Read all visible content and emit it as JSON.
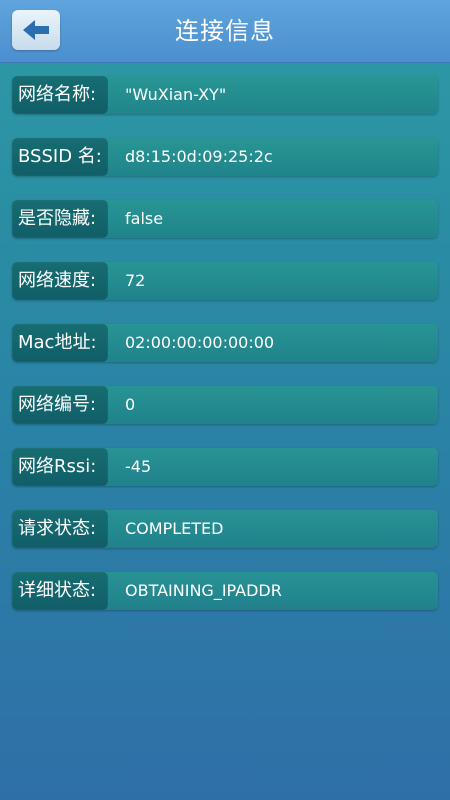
{
  "header": {
    "title": "连接信息",
    "back_icon": "back-arrow-icon"
  },
  "rows": [
    {
      "label": "网络名称:",
      "value": "\"WuXian-XY\""
    },
    {
      "label": "BSSID 名:",
      "value": "d8:15:0d:09:25:2c"
    },
    {
      "label": "是否隐藏:",
      "value": "false"
    },
    {
      "label": "网络速度:",
      "value": "72"
    },
    {
      "label": "Mac地址:",
      "value": "02:00:00:00:00:00"
    },
    {
      "label": "网络编号:",
      "value": "0"
    },
    {
      "label": "网络Rssi:",
      "value": "-45"
    },
    {
      "label": "请求状态:",
      "value": "COMPLETED"
    },
    {
      "label": "详细状态:",
      "value": "OBTAINING_IPADDR"
    }
  ],
  "colors": {
    "header": "#4b8fcf",
    "background": "#2a8fa3",
    "row": "#1e8287",
    "row_label": "#0f5a64"
  }
}
